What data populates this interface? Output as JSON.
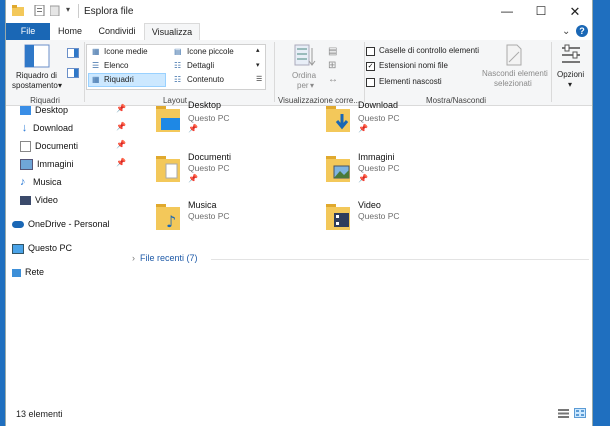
{
  "window": {
    "title": "Esplora file"
  },
  "tabs": [
    {
      "label": "File"
    },
    {
      "label": "Home"
    },
    {
      "label": "Condividi"
    },
    {
      "label": "Visualizza"
    }
  ],
  "ribbon": {
    "panes": {
      "label_line1": "Riquadro di",
      "label_line2": "spostamento",
      "group": "Riquadri"
    },
    "layout": {
      "items": [
        "Icone medie",
        "Icone piccole",
        "Elenco",
        "Dettagli",
        "Riquadri",
        "Contenuto"
      ],
      "selected": "Riquadri",
      "group": "Layout"
    },
    "current_view": {
      "sort_line1": "Ordina",
      "sort_line2": "per",
      "group": "Visualizzazione corre..."
    },
    "show_hide": {
      "checkboxes": [
        {
          "label": "Caselle di controllo elementi",
          "checked": false
        },
        {
          "label": "Estensioni nomi file",
          "checked": true
        },
        {
          "label": "Elementi nascosti",
          "checked": false
        }
      ],
      "hide_selected_line1": "Nascondi elementi",
      "hide_selected_line2": "selezionati",
      "group": "Mostra/Nascondi"
    },
    "options": {
      "label": "Opzioni"
    }
  },
  "nav": {
    "items": [
      {
        "label": "Desktop",
        "pinned": true
      },
      {
        "label": "Download",
        "pinned": true
      },
      {
        "label": "Documenti",
        "pinned": true
      },
      {
        "label": "Immagini",
        "pinned": true
      },
      {
        "label": "Musica",
        "pinned": false
      },
      {
        "label": "Video",
        "pinned": false
      },
      {
        "label": "OneDrive - Personal",
        "pinned": false
      },
      {
        "label": "Questo PC",
        "pinned": false
      },
      {
        "label": "Rete",
        "pinned": false
      }
    ]
  },
  "content": {
    "tiles": [
      {
        "name": "Desktop",
        "location": "Questo PC",
        "pinned": true
      },
      {
        "name": "Download",
        "location": "Questo PC",
        "pinned": true
      },
      {
        "name": "Documenti",
        "location": "Questo PC",
        "pinned": true
      },
      {
        "name": "Immagini",
        "location": "Questo PC",
        "pinned": true
      },
      {
        "name": "Musica",
        "location": "Questo PC",
        "pinned": false
      },
      {
        "name": "Video",
        "location": "Questo PC",
        "pinned": false
      }
    ],
    "recent_label": "File recenti (7)"
  },
  "status": {
    "count": "13 elementi"
  },
  "colors": {
    "accent": "#1a67b5",
    "folder": "#f3c85a",
    "selection": "#cce8ff"
  }
}
